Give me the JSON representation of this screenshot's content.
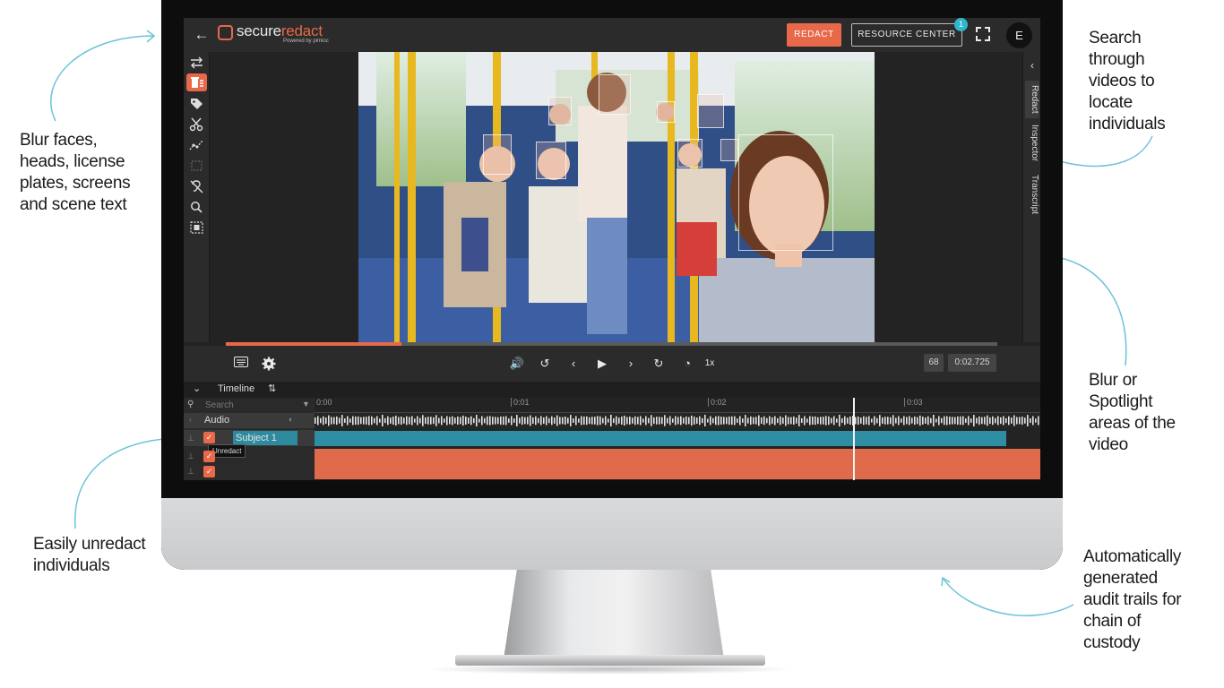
{
  "callouts": {
    "left_top": [
      "Blur faces,",
      "heads, license",
      "plates, screens",
      "and scene text"
    ],
    "left_bottom": [
      "Easily unredact",
      "individuals"
    ],
    "right_top": [
      "Search",
      "through",
      "videos to",
      "locate",
      "individuals"
    ],
    "right_middle": [
      "Blur or",
      "Spotlight",
      "areas of the",
      "video"
    ],
    "right_bottom": [
      "Automatically",
      "generated",
      "audit trails for",
      "chain of",
      "custody"
    ]
  },
  "app": {
    "logo_primary": "secure",
    "logo_accent": "redact",
    "logo_sub": "Powered by pimloc",
    "redact_label": "REDACT",
    "resource_label": "RESOURCE CENTER",
    "notification_count": "1",
    "avatar_initial": "E"
  },
  "icons": {
    "back": "back-arrow-icon",
    "toolbar": [
      "swap-icon",
      "redact-list-icon",
      "tag-icon",
      "scissors-icon",
      "trajectory-icon",
      "box-select-icon",
      "hearing-off-icon",
      "search-icon",
      "focus-icon"
    ],
    "fullscreen": "fullscreen-icon"
  },
  "right_tabs": [
    "Redact",
    "Inspector",
    "Transcript"
  ],
  "player": {
    "progress": 0.228,
    "speed": "1x",
    "frame": "68",
    "time": "0:02.725"
  },
  "timeline": {
    "label": "Timeline",
    "search_placeholder": "Search",
    "ticks": [
      "0:00",
      "0:01",
      "0:02",
      "0:03"
    ],
    "audio_label": "Audio",
    "subject_label": "Subject 1",
    "tooltip": "Unredact"
  },
  "colors": {
    "accent": "#e8684a",
    "teal": "#2fb7cf",
    "callout_arrow": "#6cc3d5"
  }
}
